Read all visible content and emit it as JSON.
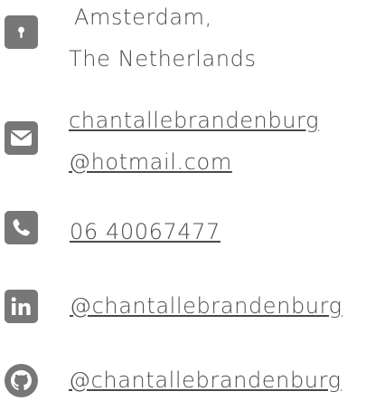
{
  "contact": {
    "location": {
      "icon": "map-pin-icon",
      "line1": "Amsterdam,",
      "line2": "The Netherlands"
    },
    "email": {
      "icon": "envelope-icon",
      "line1": "chantallebrandenburg",
      "line2": "@hotmail.com"
    },
    "phone": {
      "icon": "phone-icon",
      "number": "06 40067477"
    },
    "linkedin": {
      "icon": "linkedin-icon",
      "handle": "@chantallebrandenburg"
    },
    "github": {
      "icon": "github-icon",
      "handle": "@chantallebrandenburg"
    }
  },
  "colors": {
    "icon": "#777777",
    "text": "#4a4a4a",
    "background": "#ffffff"
  }
}
